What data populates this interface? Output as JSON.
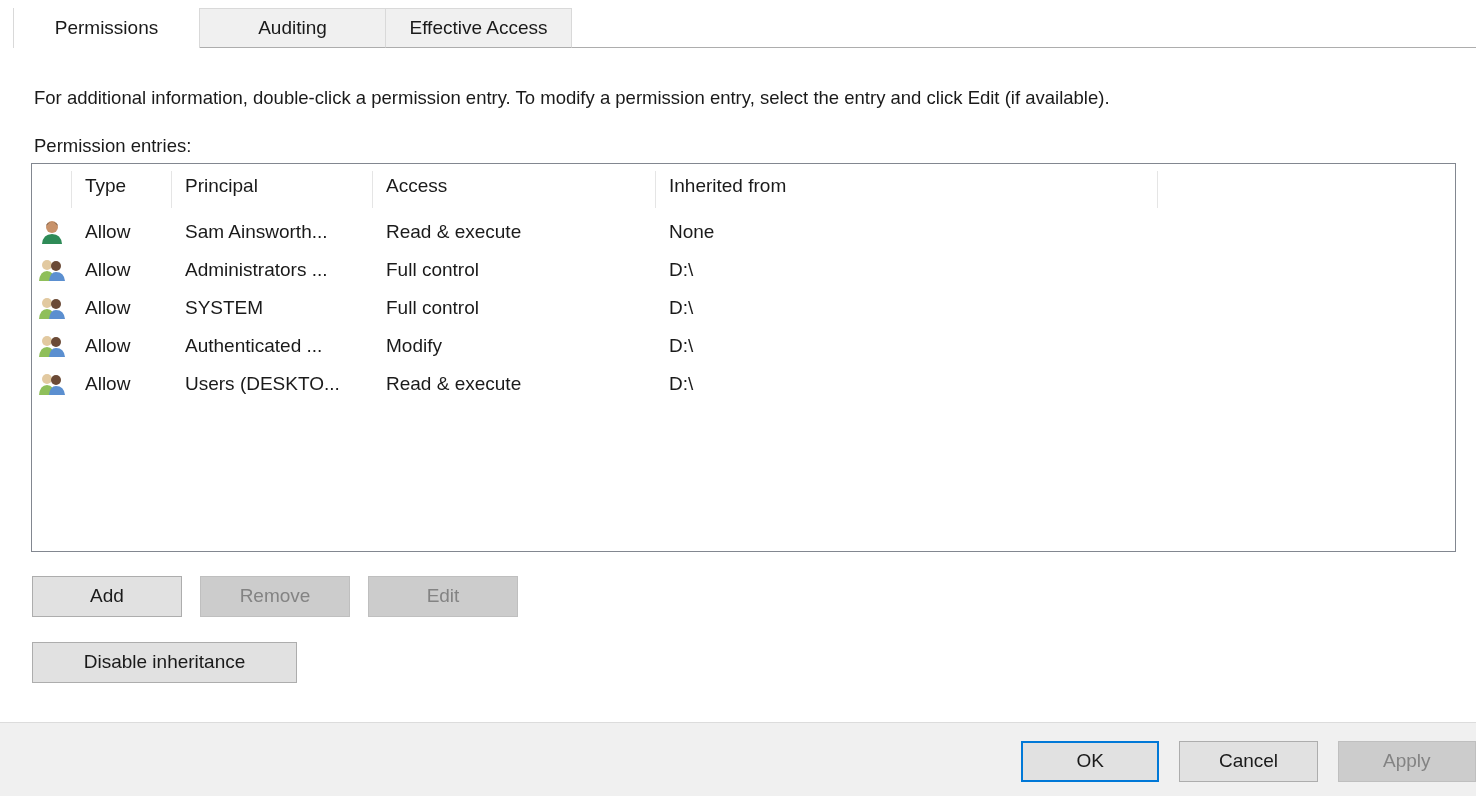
{
  "tabs": [
    {
      "label": "Permissions",
      "selected": true
    },
    {
      "label": "Auditing",
      "selected": false
    },
    {
      "label": "Effective Access",
      "selected": false
    }
  ],
  "info_text": "For additional information, double-click a permission entry. To modify a permission entry, select the entry and click Edit (if available).",
  "entries_label": "Permission entries:",
  "table": {
    "columns": [
      "Type",
      "Principal",
      "Access",
      "Inherited from"
    ],
    "rows": [
      {
        "kind": "user",
        "cells": [
          "Allow",
          "Sam Ainsworth...",
          "Read & execute",
          "None"
        ]
      },
      {
        "kind": "group",
        "cells": [
          "Allow",
          "Administrators ...",
          "Full control",
          "D:\\"
        ]
      },
      {
        "kind": "group",
        "cells": [
          "Allow",
          "SYSTEM",
          "Full control",
          "D:\\"
        ]
      },
      {
        "kind": "group",
        "cells": [
          "Allow",
          "Authenticated ...",
          "Modify",
          "D:\\"
        ]
      },
      {
        "kind": "group",
        "cells": [
          "Allow",
          "Users (DESKTO...",
          "Read & execute",
          "D:\\"
        ]
      }
    ]
  },
  "entry_buttons": [
    {
      "label": "Add",
      "disabled": false
    },
    {
      "label": "Remove",
      "disabled": true
    },
    {
      "label": "Edit",
      "disabled": true
    }
  ],
  "inheritance_button": {
    "label": "Disable inheritance",
    "disabled": false
  },
  "footer_buttons": [
    {
      "label": "OK",
      "disabled": false,
      "default": true
    },
    {
      "label": "Cancel",
      "disabled": false,
      "default": false
    },
    {
      "label": "Apply",
      "disabled": true,
      "default": false
    }
  ]
}
